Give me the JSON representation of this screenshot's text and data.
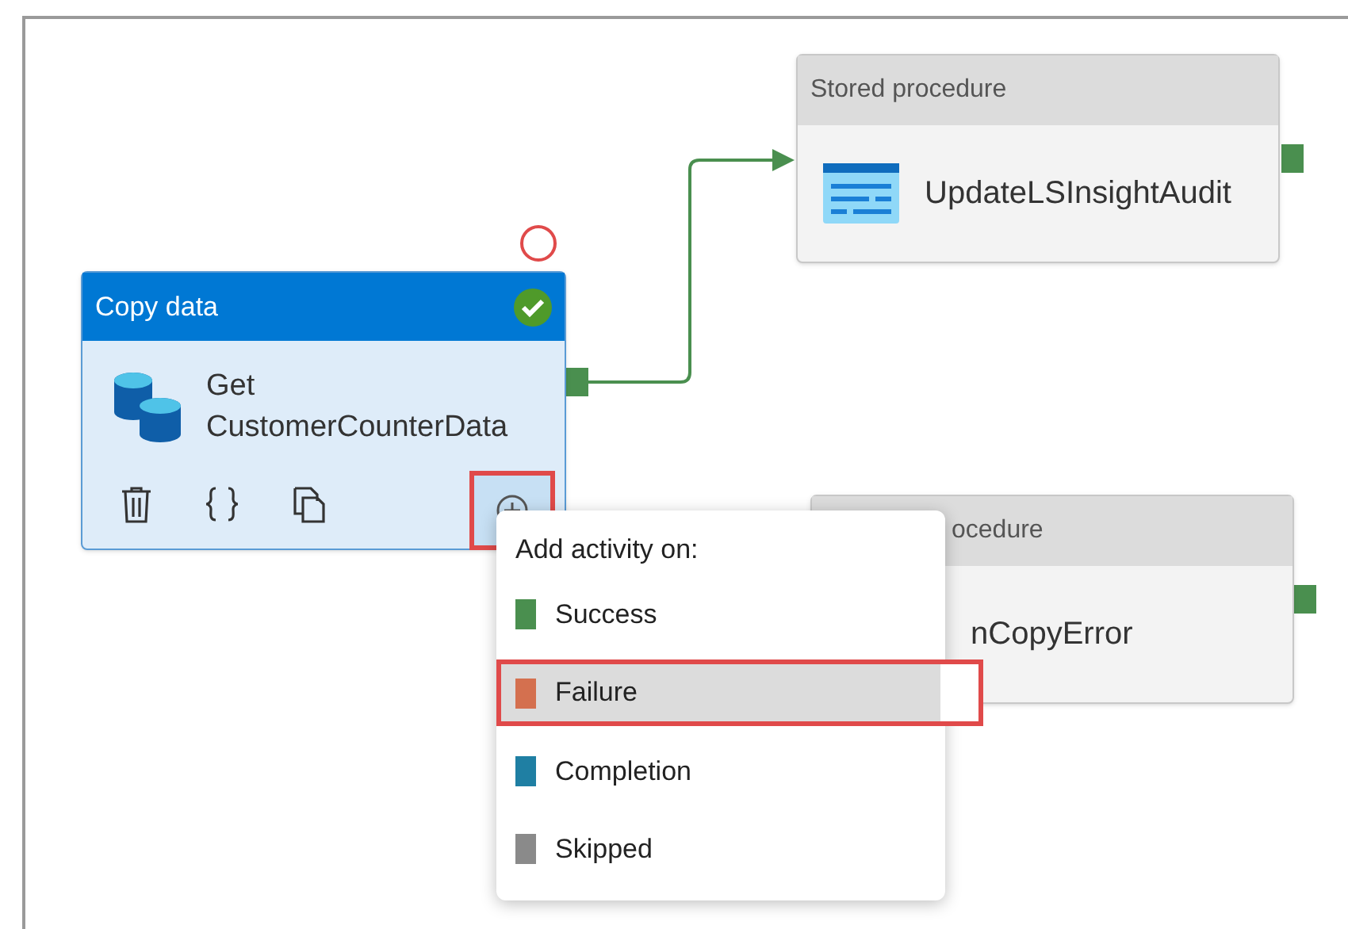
{
  "nodes": [
    {
      "kind": "stored_procedure",
      "header": "Stored procedure",
      "name": "UpdateLSInsightAudit"
    },
    {
      "kind": "copy_data",
      "header": "Copy data",
      "name_lines": [
        "Get",
        "CustomerCounterData"
      ],
      "succeeded": true,
      "add_button_highlighted": true
    },
    {
      "kind": "stored_procedure_covered",
      "header": "ocedure",
      "name": "nCopyError"
    }
  ],
  "menu": {
    "title": "Add activity on:",
    "items": [
      {
        "label": "Success",
        "color": "#4a8f4f",
        "selected": false,
        "highlighted": false
      },
      {
        "label": "Failure",
        "color": "#d4704f",
        "selected": true,
        "highlighted": true
      },
      {
        "label": "Completion",
        "color": "#1f7fa3",
        "selected": false,
        "highlighted": false
      },
      {
        "label": "Skipped",
        "color": "#8a8a8a",
        "selected": false,
        "highlighted": false
      }
    ]
  }
}
